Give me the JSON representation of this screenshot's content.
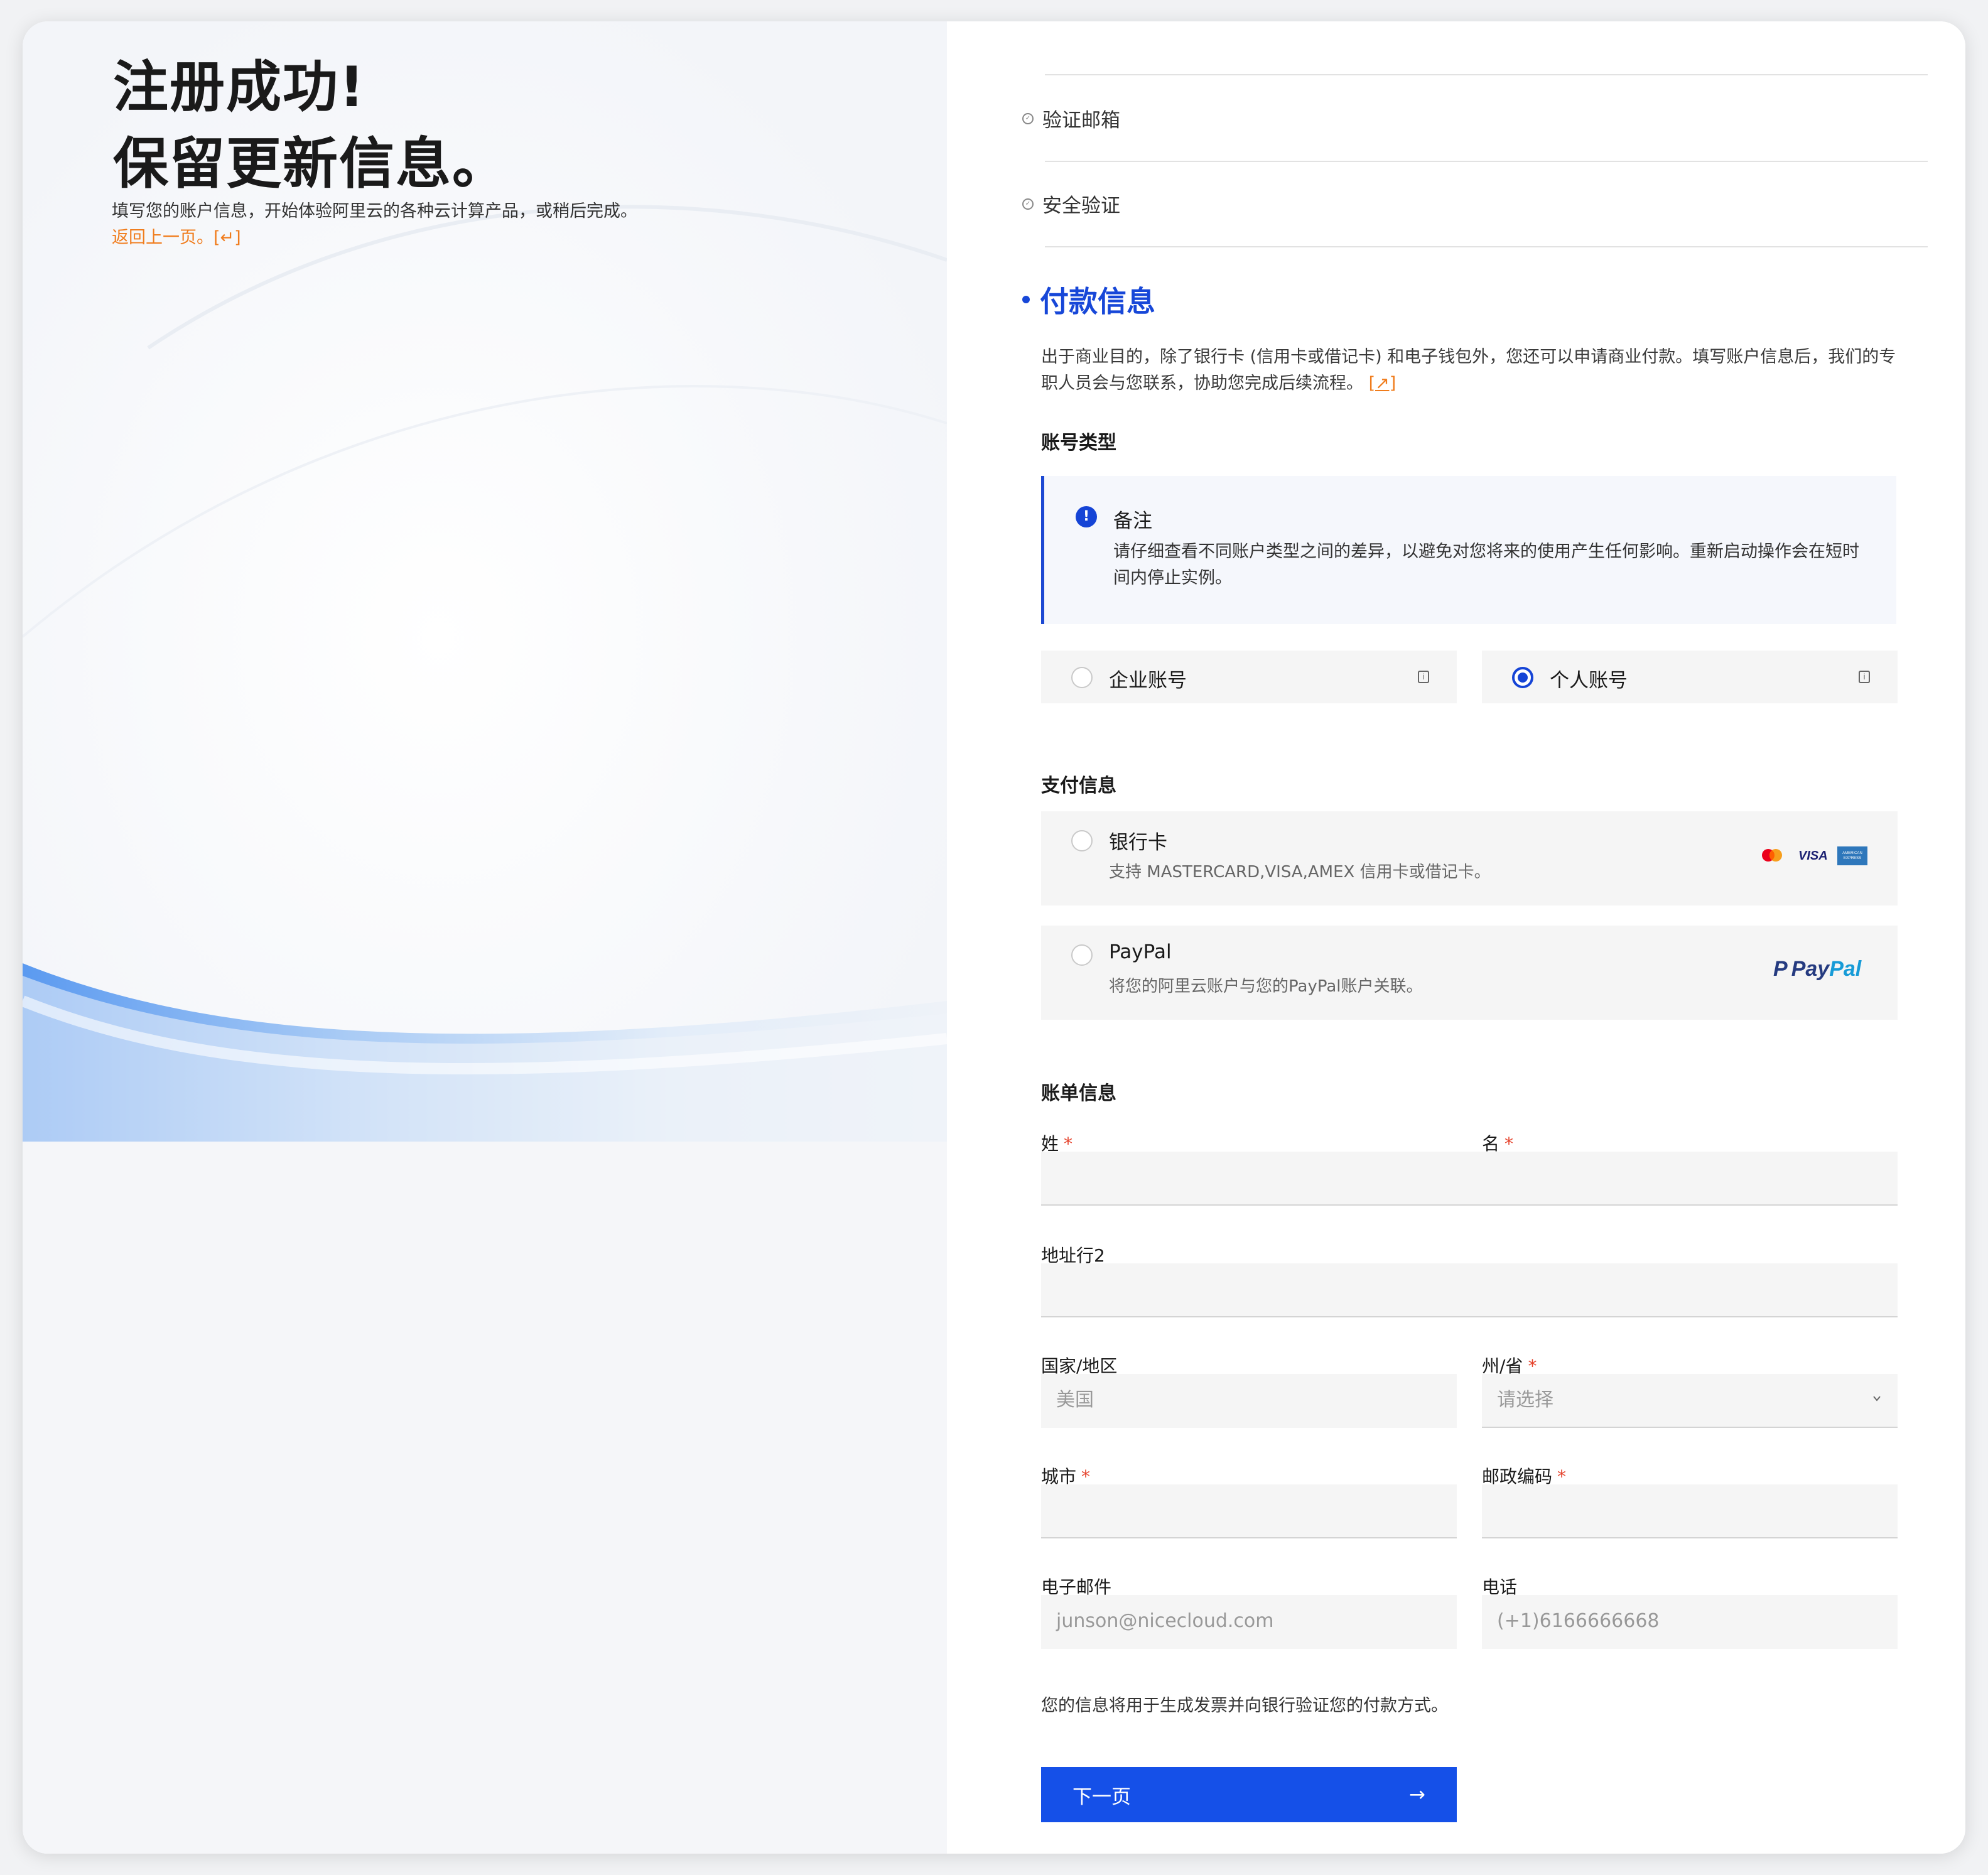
{
  "hero": {
    "title_line1": "注册成功!",
    "title_line2": "保留更新信息。",
    "subtitle": "填写您的账户信息，开始体验阿里云的各种云计算产品，或稍后完成。",
    "back_link": "返回上一页。[↵]"
  },
  "steps": {
    "verify_email": "验证邮箱",
    "security": "安全验证",
    "payment": "付款信息"
  },
  "description": {
    "text": "出于商业目的，除了银行卡 (信用卡或借记卡) 和电子钱包外，您还可以申请商业付款。填写账户信息后，我们的专职人员会与您联系，协助您完成后续流程。",
    "link": "[↗]"
  },
  "account_type": {
    "heading": "账号类型",
    "note_title": "备注",
    "note_body": "请仔细查看不同账户类型之间的差异，以避免对您将来的使用产生任何影响。重新启动操作会在短时间内停止实例。",
    "options": [
      {
        "label": "企业账号",
        "selected": false
      },
      {
        "label": "个人账号",
        "selected": true
      }
    ]
  },
  "payment": {
    "heading": "支付信息",
    "bank_card": {
      "label": "银行卡",
      "sub": "支持 MASTERCARD,VISA,AMEX 信用卡或借记卡。",
      "visa_text": "VISA",
      "amex_text": "AMERICAN EXPRESS"
    },
    "paypal": {
      "label": "PayPal",
      "sub": "将您的阿里云账户与您的PayPal账户关联。",
      "logo_pay": "Pay",
      "logo_pal": "Pal"
    }
  },
  "billing": {
    "heading": "账单信息",
    "last_name": "姓",
    "first_name": "名",
    "address2": "地址行2",
    "country": "国家/地区",
    "country_value": "美国",
    "state": "州/省",
    "state_placeholder": "请选择",
    "city": "城市",
    "zip": "邮政编码",
    "email": "电子邮件",
    "email_placeholder": "junson@nicecloud.com",
    "phone": "电话",
    "phone_placeholder": "(+1)6166666668",
    "required_mark": "*"
  },
  "footer": {
    "note": "您的信息将用于生成发票并向银行验证您的付款方式。",
    "next_label": "下一页",
    "next_arrow": "→"
  },
  "colors": {
    "accent": "#1550e8",
    "link": "#f07c1c",
    "required": "#e5412a"
  }
}
